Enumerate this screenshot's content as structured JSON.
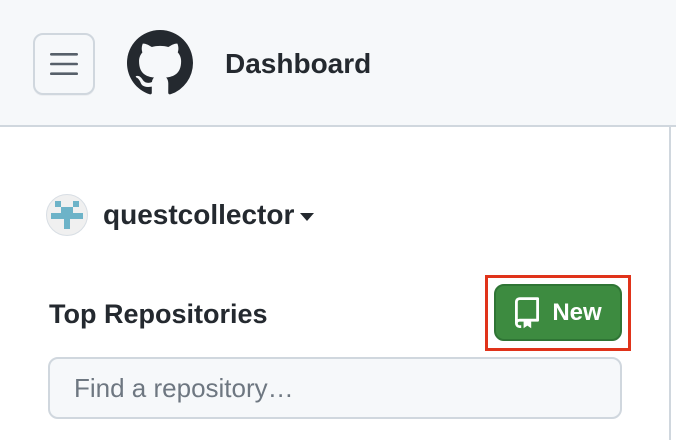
{
  "header": {
    "title": "Dashboard",
    "menu_icon": "hamburger-icon",
    "logo_icon": "github-logo-icon"
  },
  "account": {
    "name": "questcollector",
    "avatar_icon": "identicon-avatar",
    "caret_icon": "caret-down-icon"
  },
  "repositories": {
    "title": "Top Repositories",
    "new_label": "New",
    "new_icon": "repo-icon",
    "search_placeholder": "Find a repository…"
  },
  "colors": {
    "header_bg": "#f6f8fa",
    "primary_button": "#3d8b40",
    "highlight_outline": "#e0331a",
    "avatar_accent": "#6db3c8",
    "text": "#24292f"
  }
}
